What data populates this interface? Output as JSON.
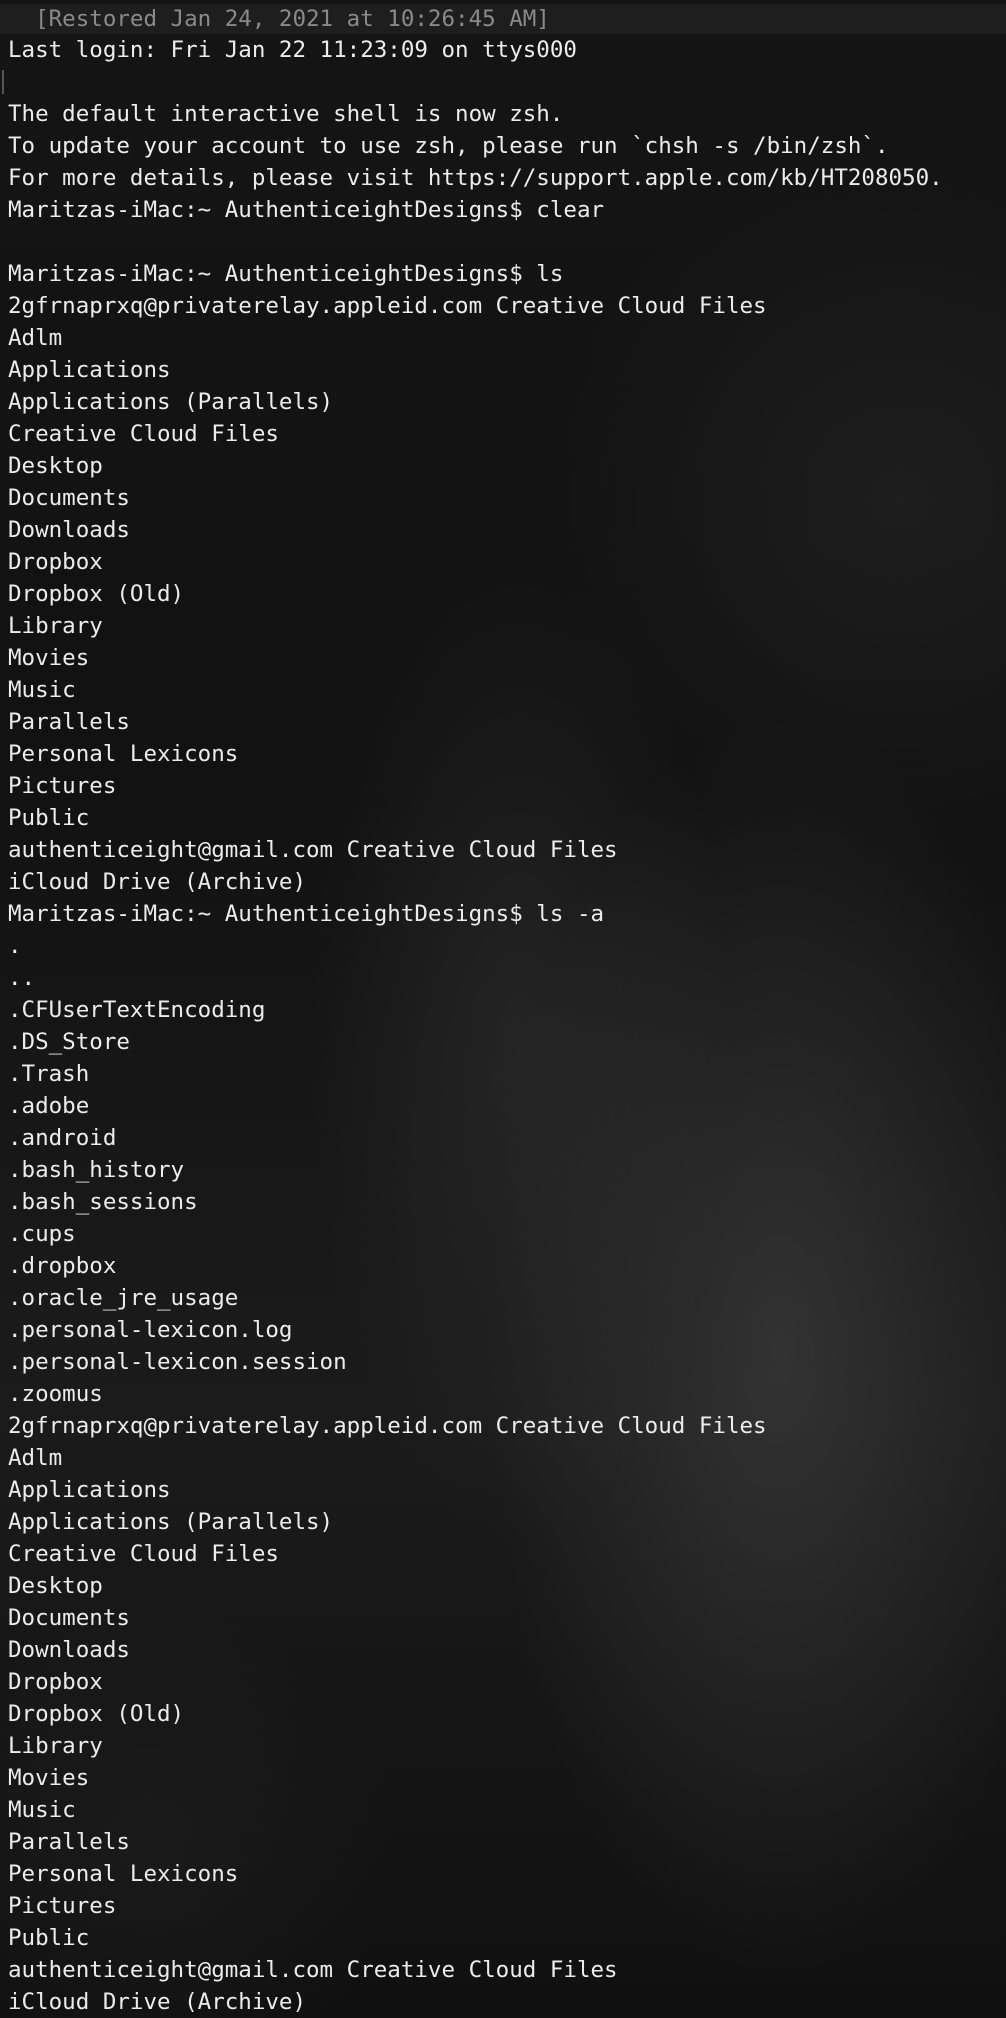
{
  "terminal": {
    "restored_banner": "  [Restored Jan 24, 2021 at 10:26:45 AM]",
    "lines": [
      "Last login: Fri Jan 22 11:23:09 on ttys000",
      "",
      "The default interactive shell is now zsh.",
      "To update your account to use zsh, please run `chsh -s /bin/zsh`.",
      "For more details, please visit https://support.apple.com/kb/HT208050.",
      "Maritzas-iMac:~ AuthenticeightDesigns$ clear",
      "",
      "Maritzas-iMac:~ AuthenticeightDesigns$ ls",
      "2gfrnaprxq@privaterelay.appleid.com Creative Cloud Files",
      "Adlm",
      "Applications",
      "Applications (Parallels)",
      "Creative Cloud Files",
      "Desktop",
      "Documents",
      "Downloads",
      "Dropbox",
      "Dropbox (Old)",
      "Library",
      "Movies",
      "Music",
      "Parallels",
      "Personal Lexicons",
      "Pictures",
      "Public",
      "authenticeight@gmail.com Creative Cloud Files",
      "iCloud Drive (Archive)",
      "Maritzas-iMac:~ AuthenticeightDesigns$ ls -a",
      ".",
      "..",
      ".CFUserTextEncoding",
      ".DS_Store",
      ".Trash",
      ".adobe",
      ".android",
      ".bash_history",
      ".bash_sessions",
      ".cups",
      ".dropbox",
      ".oracle_jre_usage",
      ".personal-lexicon.log",
      ".personal-lexicon.session",
      ".zoomus",
      "2gfrnaprxq@privaterelay.appleid.com Creative Cloud Files",
      "Adlm",
      "Applications",
      "Applications (Parallels)",
      "Creative Cloud Files",
      "Desktop",
      "Documents",
      "Downloads",
      "Dropbox",
      "Dropbox (Old)",
      "Library",
      "Movies",
      "Music",
      "Parallels",
      "Personal Lexicons",
      "Pictures",
      "Public",
      "authenticeight@gmail.com Creative Cloud Files",
      "iCloud Drive (Archive)"
    ]
  }
}
